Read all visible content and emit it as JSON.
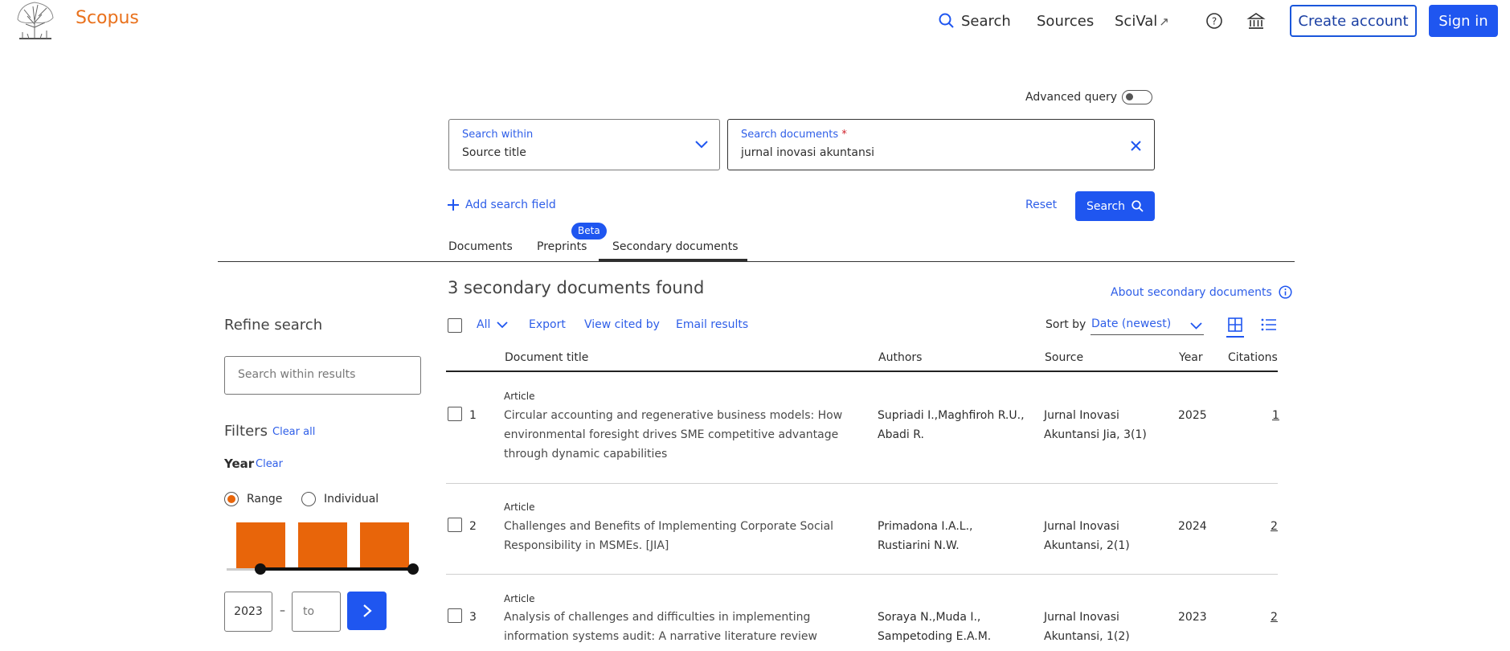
{
  "brand": {
    "name": "Scopus",
    "logo_icon": "elsevier-tree-logo"
  },
  "topnav": {
    "search": "Search",
    "sources": "Sources",
    "scival": "SciVal",
    "scival_icon": "↗",
    "help_icon": "help-circle-icon",
    "institution_icon": "institution-icon",
    "create_account": "Create account",
    "sign_in": "Sign in"
  },
  "query": {
    "advanced_query_label": "Advanced query",
    "advanced_query_on": false,
    "search_within_label": "Search within",
    "search_within_value": "Source title",
    "search_documents_label": "Search documents",
    "required_mark": "*",
    "search_documents_value": "jurnal inovasi akuntansi",
    "add_field": "Add search field",
    "reset": "Reset",
    "search_button": "Search"
  },
  "tabs": [
    {
      "label": "Documents",
      "active": false
    },
    {
      "label": "Preprints",
      "active": false,
      "badge": "Beta"
    },
    {
      "label": "Secondary documents",
      "active": true
    }
  ],
  "results": {
    "heading": "3 secondary documents found",
    "about_link": "About secondary documents",
    "toolbar": {
      "all": "All",
      "export": "Export",
      "view_cited_by": "View cited by",
      "email_results": "Email results",
      "sort_by_label": "Sort by",
      "sort_value": "Date (newest)"
    },
    "columns": {
      "title": "Document title",
      "authors": "Authors",
      "source": "Source",
      "year": "Year",
      "citations": "Citations"
    },
    "rows": [
      {
        "num": "1",
        "type": "Article",
        "title_lines": [
          "Circular accounting and regenerative business models: How",
          "environmental foresight drives SME competitive advantage",
          "through dynamic capabilities"
        ],
        "author_lines": [
          "Supriadi I.,Maghfiroh R.U.,",
          "Abadi R."
        ],
        "source_lines": [
          "Jurnal Inovasi",
          "Akuntansi Jia, 3(1)"
        ],
        "year": "2025",
        "citations": "1"
      },
      {
        "num": "2",
        "type": "Article",
        "title_lines": [
          "Challenges and Benefits of Implementing Corporate Social",
          "Responsibility in MSMEs. [JIA]"
        ],
        "author_lines": [
          "Primadona I.A.L.,",
          "Rustiarini N.W."
        ],
        "source_lines": [
          "Jurnal Inovasi",
          "Akuntansi, 2(1)"
        ],
        "year": "2024",
        "citations": "2"
      },
      {
        "num": "3",
        "type": "Article",
        "title_lines": [
          "Analysis of challenges and difficulties in implementing",
          "information systems audit: A narrative literature review"
        ],
        "author_lines": [
          "Soraya N.,Muda I.,",
          "Sampetoding E.A.M."
        ],
        "source_lines": [
          "Jurnal Inovasi",
          "Akuntansi, 1(2)"
        ],
        "year": "2023",
        "citations": "2"
      }
    ]
  },
  "sidebar": {
    "refine_title": "Refine search",
    "search_within_placeholder": "Search within results",
    "filters_label": "Filters",
    "clear_all": "Clear all",
    "year_label": "Year",
    "year_clear": "Clear",
    "range_label": "Range",
    "individual_label": "Individual",
    "range_selected": true,
    "year_histogram": [
      1,
      1,
      1
    ],
    "year_from": "2023",
    "year_to_placeholder": "to",
    "year_dash": "–"
  },
  "colors": {
    "accent": "#1f56f0",
    "brand": "#e9711c",
    "histogram": "#e8650a"
  }
}
